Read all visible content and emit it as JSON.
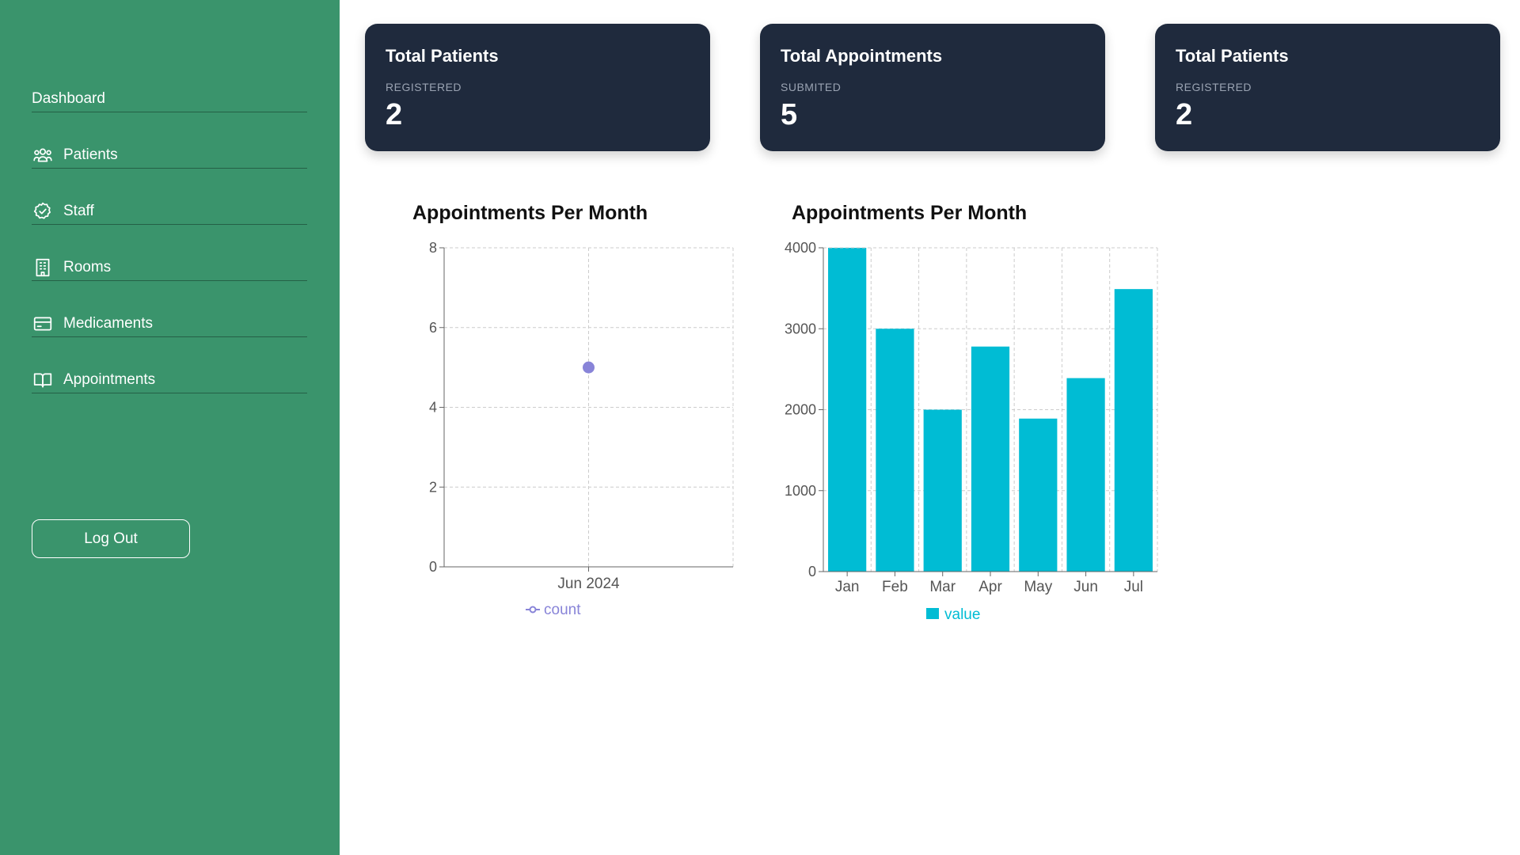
{
  "sidebar": {
    "items": [
      {
        "label": "Dashboard",
        "icon": "none"
      },
      {
        "label": "Patients",
        "icon": "users-icon"
      },
      {
        "label": "Staff",
        "icon": "badge-check-icon"
      },
      {
        "label": "Rooms",
        "icon": "building-icon"
      },
      {
        "label": "Medicaments",
        "icon": "card-icon"
      },
      {
        "label": "Appointments",
        "icon": "book-icon"
      }
    ],
    "logout_label": "Log Out"
  },
  "cards": [
    {
      "title": "Total Patients",
      "subtitle": "REGISTERED",
      "value": "2"
    },
    {
      "title": "Total Appointments",
      "subtitle": "SUBMITED",
      "value": "5"
    },
    {
      "title": "Total Patients",
      "subtitle": "REGISTERED",
      "value": "2"
    }
  ],
  "colors": {
    "sidebar": "#3a946c",
    "card": "#1f2a3d",
    "line_series": "#8884d8",
    "bar_series": "#00bcd4"
  },
  "chart_data": [
    {
      "type": "scatter",
      "title": "Appointments Per Month",
      "x": [
        "Jun 2024"
      ],
      "series": [
        {
          "name": "count",
          "values": [
            5
          ]
        }
      ],
      "ylim": [
        0,
        8
      ],
      "yticks": [
        0,
        2,
        4,
        6,
        8
      ],
      "grid": true,
      "legend": "bottom"
    },
    {
      "type": "bar",
      "title": "Appointments Per Month",
      "categories": [
        "Jan",
        "Feb",
        "Mar",
        "Apr",
        "May",
        "Jun",
        "Jul"
      ],
      "series": [
        {
          "name": "value",
          "values": [
            4000,
            3000,
            2000,
            2780,
            1890,
            2390,
            3490
          ]
        }
      ],
      "ylim": [
        0,
        4000
      ],
      "yticks": [
        0,
        1000,
        2000,
        3000,
        4000
      ],
      "grid": true,
      "legend": "bottom"
    }
  ]
}
